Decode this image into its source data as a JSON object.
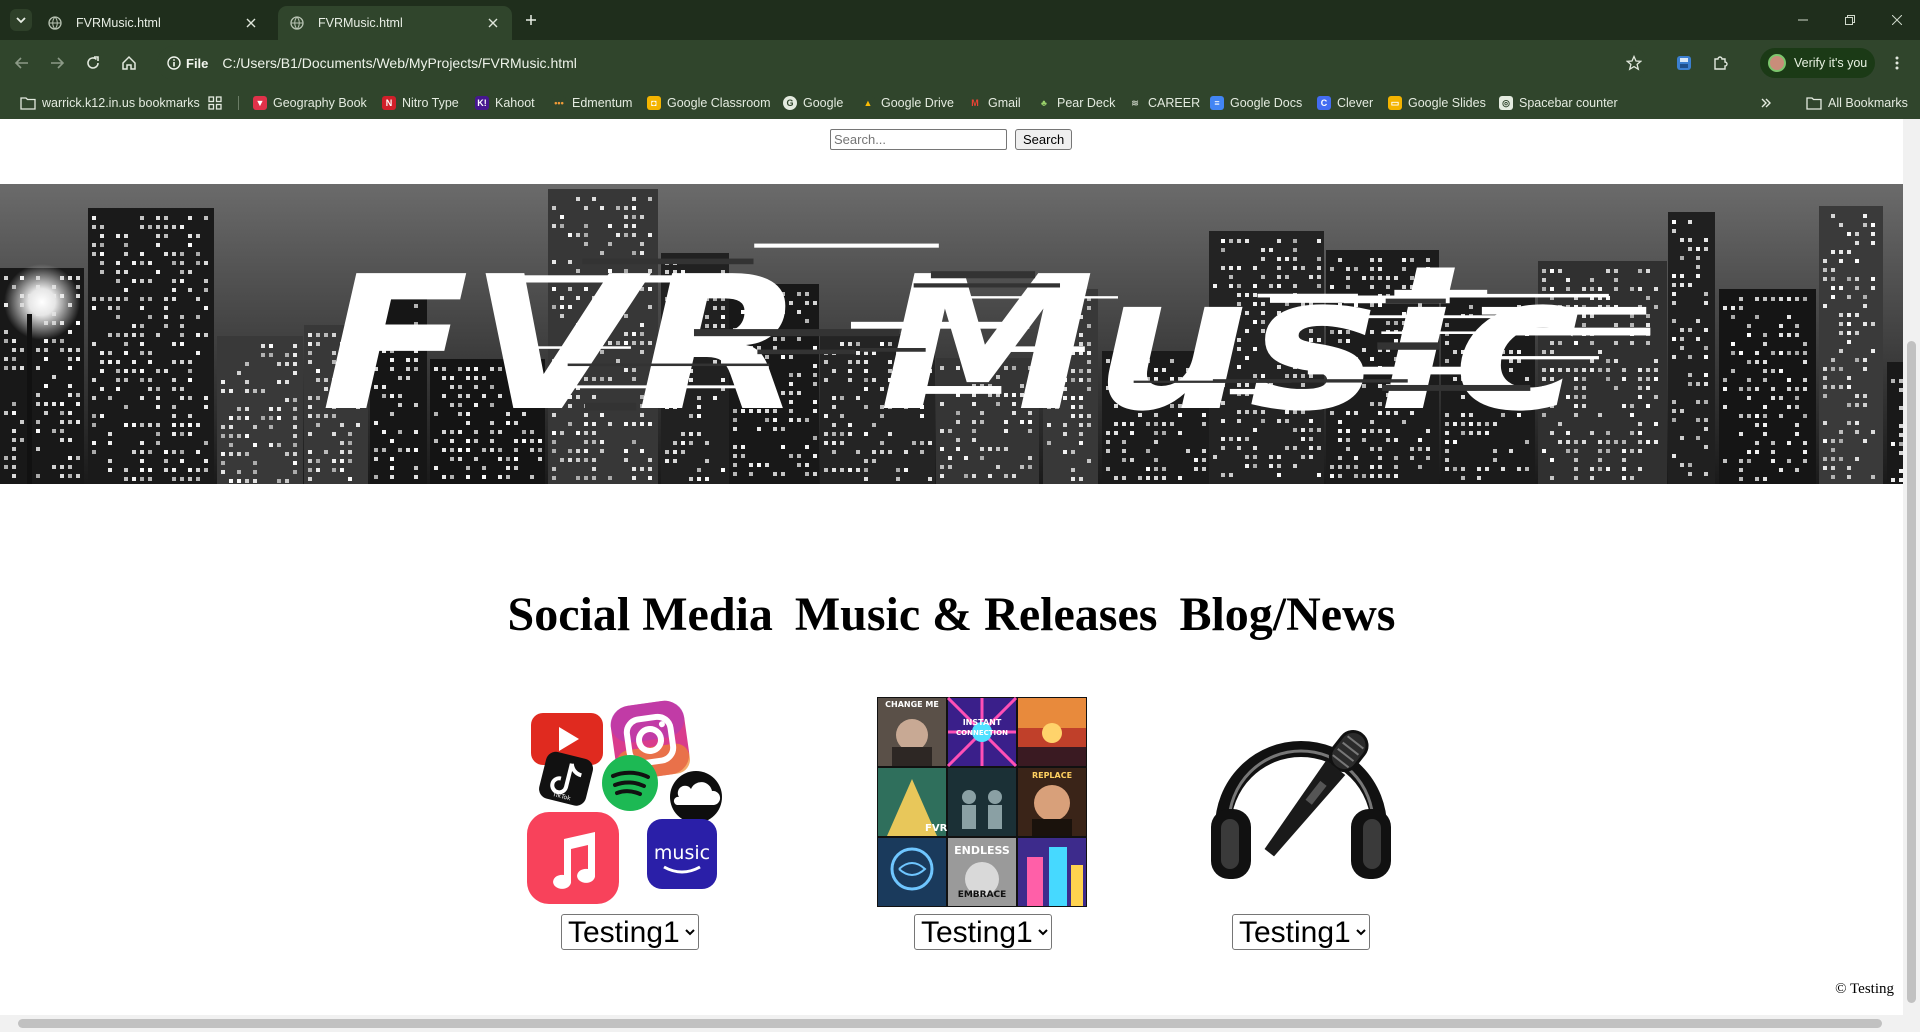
{
  "browser": {
    "tabs": [
      {
        "title": "FVRMusic.html",
        "active": false
      },
      {
        "title": "FVRMusic.html",
        "active": true
      }
    ],
    "site_chip": "File",
    "url": "C:/Users/B1/Documents/Web/MyProjects/FVRMusic.html",
    "profile_label": "Verify it's you",
    "bookmarks": [
      {
        "label": "warrick.k12.in.us bookmarks",
        "icon": "folder-shared-icon"
      },
      {
        "label": "Geography Book",
        "icon": "geography-book-icon"
      },
      {
        "label": "Nitro Type",
        "icon": "nitro-type-icon"
      },
      {
        "label": "Kahoot",
        "icon": "kahoot-icon"
      },
      {
        "label": "Edmentum",
        "icon": "edmentum-icon"
      },
      {
        "label": "Google Classroom",
        "icon": "google-classroom-icon"
      },
      {
        "label": "Google",
        "icon": "google-icon"
      },
      {
        "label": "Google Drive",
        "icon": "google-drive-icon"
      },
      {
        "label": "Gmail",
        "icon": "gmail-icon"
      },
      {
        "label": "Pear Deck",
        "icon": "pear-deck-icon"
      },
      {
        "label": "CAREER",
        "icon": "career-icon"
      },
      {
        "label": "Google Docs",
        "icon": "google-docs-icon"
      },
      {
        "label": "Clever",
        "icon": "clever-icon"
      },
      {
        "label": "Google Slides",
        "icon": "google-slides-icon"
      },
      {
        "label": "Spacebar counter",
        "icon": "spacebar-counter-icon"
      }
    ],
    "all_bookmarks": "All Bookmarks",
    "colors": {
      "frame": "#1f2e1c",
      "toolbar": "#30452c"
    }
  },
  "page": {
    "search": {
      "placeholder": "Search...",
      "button": "Search"
    },
    "hero": {
      "title": "FVR Music"
    },
    "nav": [
      {
        "label": "Social Media"
      },
      {
        "label": "Music & Releases"
      },
      {
        "label": "Blog/News"
      }
    ],
    "cards": [
      {
        "image": "social-media-app-icons-collage",
        "select_value": "Testing1"
      },
      {
        "image": "album-covers-collage",
        "select_value": "Testing1"
      },
      {
        "image": "headphones-microphone-icon",
        "select_value": "Testing1"
      }
    ],
    "footer": "© Testing"
  }
}
